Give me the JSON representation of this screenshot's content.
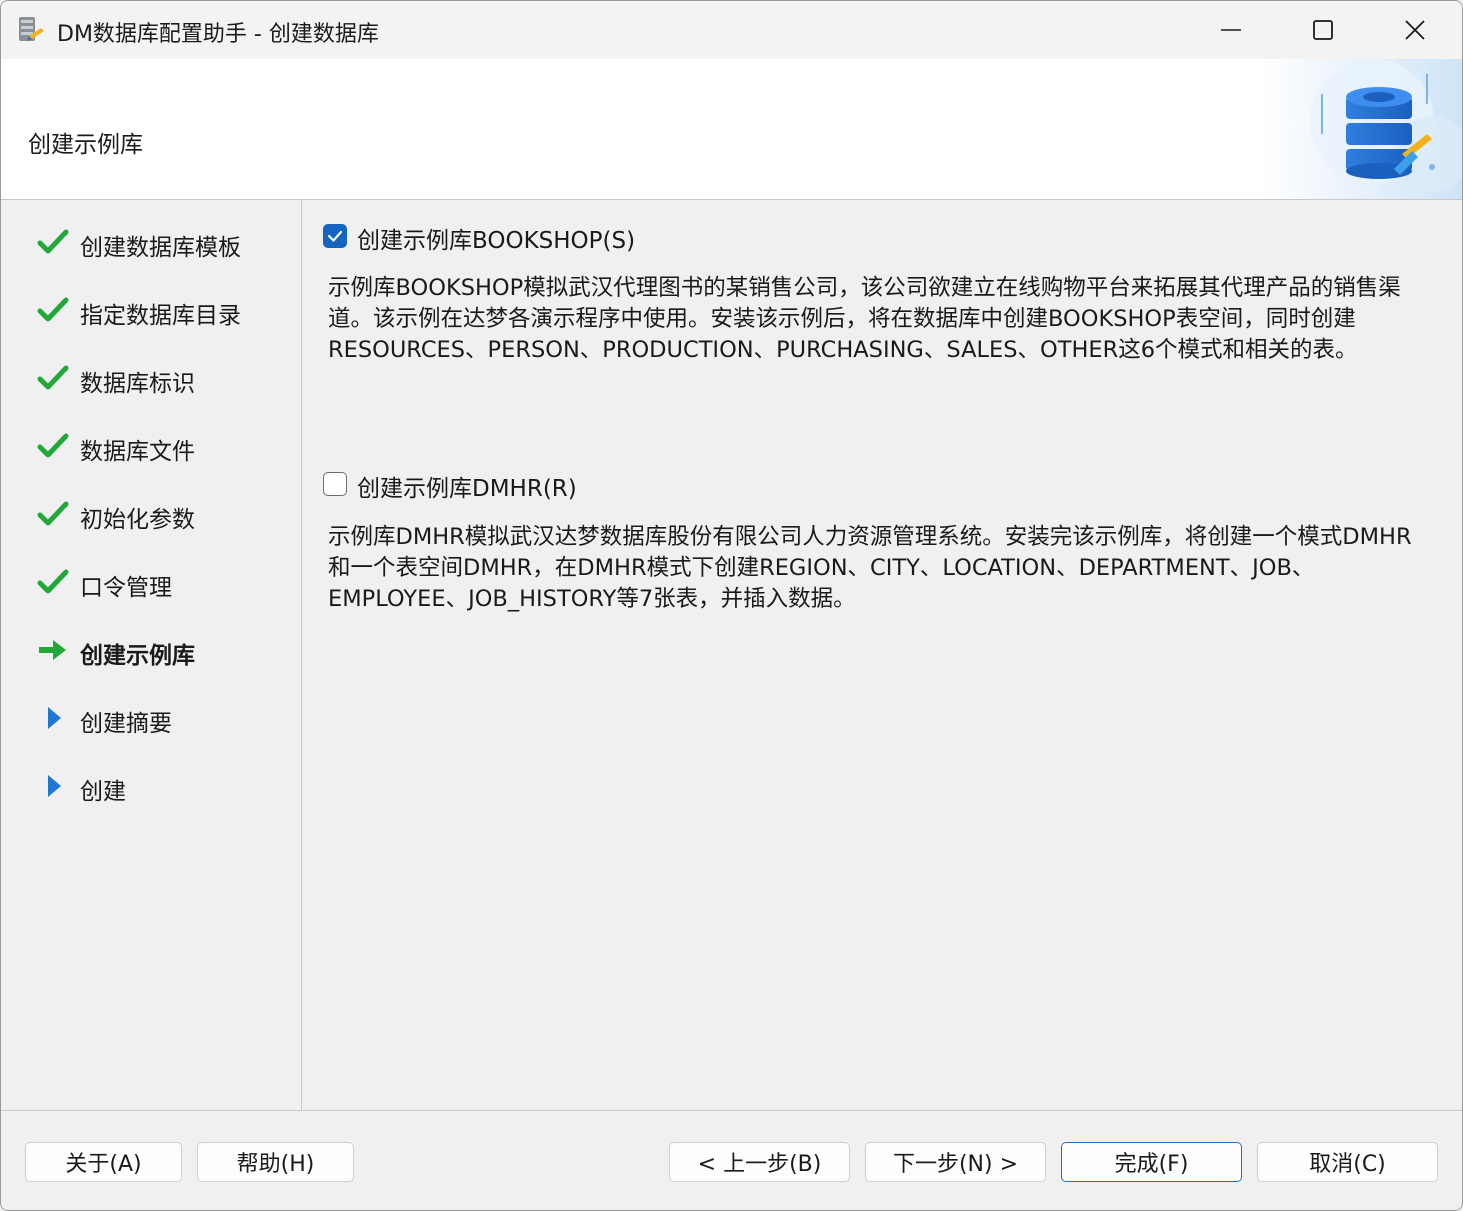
{
  "window": {
    "title": "DM数据库配置助手 - 创建数据库"
  },
  "banner": {
    "title": "创建示例库"
  },
  "sidebar": {
    "steps": [
      {
        "label": "创建数据库模板",
        "status": "done"
      },
      {
        "label": "指定数据库目录",
        "status": "done"
      },
      {
        "label": "数据库标识",
        "status": "done"
      },
      {
        "label": "数据库文件",
        "status": "done"
      },
      {
        "label": "初始化参数",
        "status": "done"
      },
      {
        "label": "口令管理",
        "status": "done"
      },
      {
        "label": "创建示例库",
        "status": "current"
      },
      {
        "label": "创建摘要",
        "status": "pending"
      },
      {
        "label": "创建",
        "status": "pending"
      }
    ]
  },
  "main": {
    "bookshop": {
      "label": "创建示例库BOOKSHOP(S)",
      "checked": true,
      "description": "示例库BOOKSHOP模拟武汉代理图书的某销售公司，该公司欲建立在线购物平台来拓展其代理产品的销售渠道。该示例在达梦各演示程序中使用。安装该示例后，将在数据库中创建BOOKSHOP表空间，同时创建RESOURCES、PERSON、PRODUCTION、PURCHASING、SALES、OTHER这6个模式和相关的表。"
    },
    "dmhr": {
      "label": "创建示例库DMHR(R)",
      "checked": false,
      "description": "示例库DMHR模拟武汉达梦数据库股份有限公司人力资源管理系统。安装完该示例库，将创建一个模式DMHR和一个表空间DMHR，在DMHR模式下创建REGION、CITY、LOCATION、DEPARTMENT、JOB、EMPLOYEE、JOB_HISTORY等7张表，并插入数据。"
    }
  },
  "footer": {
    "about": "关于(A)",
    "help": "帮助(H)",
    "prev": "< 上一步(B)",
    "next": "下一步(N) >",
    "finish": "完成(F)",
    "cancel": "取消(C)"
  },
  "colors": {
    "check_green": "#22a838",
    "arrow_green": "#22a838",
    "pending_blue": "#1e78d2",
    "checkbox_blue": "#1565c0"
  },
  "icons": {
    "done": "check-icon",
    "current": "arrow-right-icon",
    "pending": "triangle-right-icon"
  }
}
